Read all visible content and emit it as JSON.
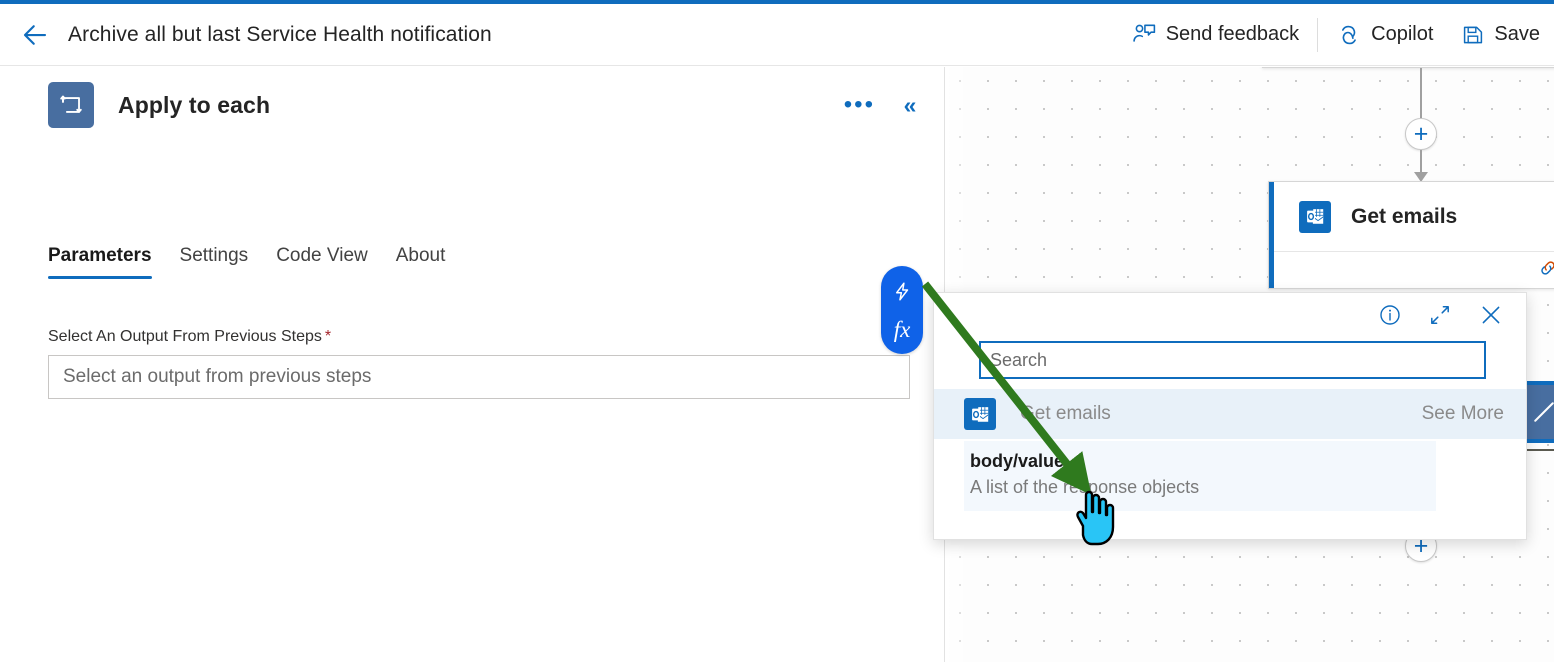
{
  "theme": {
    "accent": "#0f6cbd",
    "pill_blue": "#0f62e8",
    "node_slate": "#486ea0",
    "required_red": "#a4262c",
    "annotation_green": "#2f7a1e",
    "cursor_cyan": "#29c5f6"
  },
  "commandbar": {
    "back_icon": "back-arrow-icon",
    "title": "Archive all but last Service Health notification",
    "actions": [
      {
        "label": "Send feedback",
        "icon": "person-feedback-icon"
      },
      {
        "label": "Copilot",
        "icon": "copilot-icon"
      },
      {
        "label": "Save",
        "icon": "save-disk-icon"
      }
    ]
  },
  "panel": {
    "node_icon": "apply-to-each-loop-icon",
    "node_title": "Apply to each",
    "more_label": "•••",
    "collapse_label": "«",
    "tabs": [
      {
        "label": "Parameters",
        "selected": true
      },
      {
        "label": "Settings",
        "selected": false
      },
      {
        "label": "Code View",
        "selected": false
      },
      {
        "label": "About",
        "selected": false
      }
    ],
    "field": {
      "label": "Select An Output From Previous Steps",
      "required_mark": "*",
      "value": "",
      "placeholder": "Select an output from previous steps"
    },
    "pill": {
      "dynamic_content_icon": "lightning-bolt-icon",
      "expression_label": "fx"
    }
  },
  "flyout": {
    "info_icon": "info-circle-icon",
    "expand_icon": "expand-diagonal-icon",
    "close_icon": "close-x-icon",
    "search": {
      "value": "",
      "placeholder": "Search"
    },
    "groups": [
      {
        "icon": "outlook-icon",
        "name": "Get emails",
        "see_more_label": "See More",
        "items": [
          {
            "name": "body/value",
            "description": "A list of the response objects"
          }
        ]
      }
    ]
  },
  "canvas": {
    "nodes": [
      {
        "name": "",
        "icon": "",
        "kind": "partial-top"
      },
      {
        "name": "Get emails",
        "icon": "outlook-icon",
        "kind": "action"
      },
      {
        "name": "",
        "icon": "apply-to-each-loop-icon",
        "kind": "partial-right"
      }
    ],
    "add_step_label": "+"
  }
}
